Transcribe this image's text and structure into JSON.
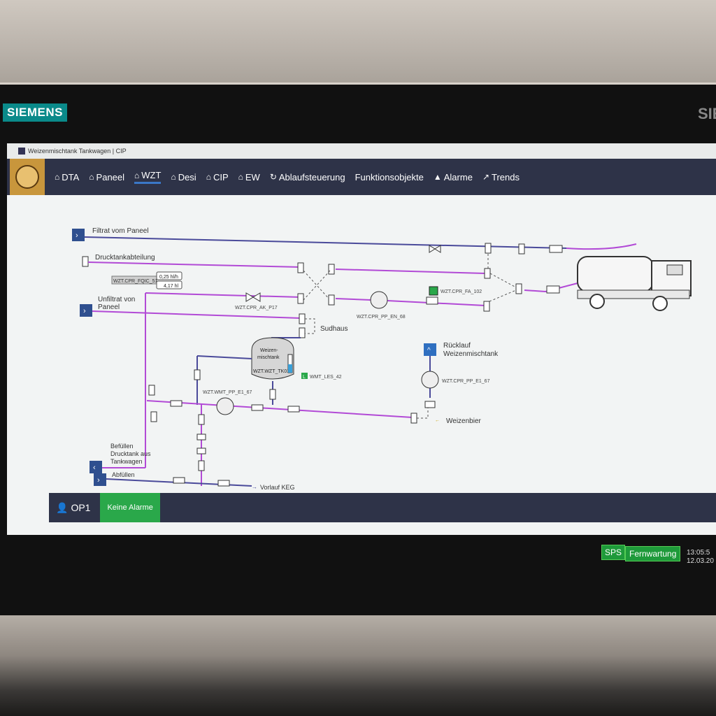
{
  "brand": {
    "name": "SIEMENS",
    "edge": "SIE"
  },
  "window": {
    "title": "Weizenmischtank Tankwagen | CIP"
  },
  "nav": {
    "items": [
      {
        "label": "DTA",
        "icon": "home-icon"
      },
      {
        "label": "Paneel",
        "icon": "home-icon"
      },
      {
        "label": "WZT",
        "icon": "home-icon",
        "active": true
      },
      {
        "label": "Desi",
        "icon": "home-icon"
      },
      {
        "label": "CIP",
        "icon": "home-icon"
      },
      {
        "label": "EW",
        "icon": "home-icon"
      },
      {
        "label": "Ablaufsteuerung",
        "icon": "refresh-icon"
      },
      {
        "label": "Funktionsobjekte",
        "icon": ""
      },
      {
        "label": "Alarme",
        "icon": "warning-icon"
      },
      {
        "label": "Trends",
        "icon": "trend-icon"
      }
    ]
  },
  "diagram": {
    "filtrat": "Filtrat vom Paneel",
    "drucktank": "Drucktankabteilung",
    "unfiltrat1": "Unfiltrat von",
    "unfiltrat2": "Paneel",
    "fqic_tag": "WZT.CPR_FQIC_51",
    "fqic_rate": "0,25 hl/h",
    "fqic_total": "4,17 hl",
    "ak_tag": "WZT.CPR_AK_P17",
    "pump_en": "WZT.CPR_PP_EN_68",
    "fa_tag": "WZT.CPR_FA_102",
    "sudhaus": "Sudhaus",
    "tank1": "Weizen-",
    "tank2": "mischtank",
    "tank_tag": "WZT.WZT_TK01",
    "les_tag": "WMT_LES_42",
    "les_badge": "L",
    "ruecklauf1": "Rücklauf",
    "ruecklauf2": "Weizenmischtank",
    "pump_rl": "WZT.CPR_PP_E1_67",
    "pump_wmt": "WZT.WMT_PP_E1_67",
    "weizenbier": "Weizenbier",
    "befuellen1": "Befüllen",
    "befuellen2": "Drucktank aus",
    "befuellen3": "Tankwagen",
    "abfuellen": "Abfüllen",
    "vorlauf": "Vorlauf KEG"
  },
  "footer": {
    "user": "OP1",
    "alarm": "Keine Alarme"
  },
  "status": {
    "sps": "SPS",
    "fernwartung": "Fernwartung",
    "time": "13:05:5",
    "date": "12.03.20"
  },
  "colors": {
    "pipe_violet": "#b24ad6",
    "pipe_blue": "#4a4a9a",
    "nav_bg": "#2e3348",
    "ok_green": "#2aa84a",
    "accent_blue": "#2f6fc0"
  }
}
